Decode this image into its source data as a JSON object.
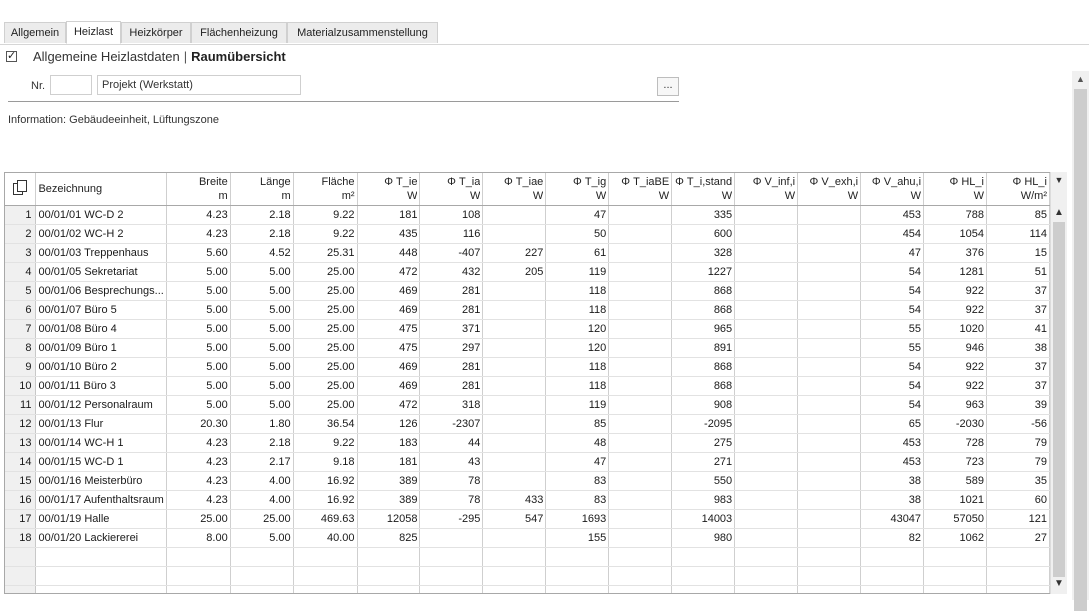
{
  "tabs": [
    {
      "label": "Allgemein"
    },
    {
      "label": "Heizlast",
      "active": true
    },
    {
      "label": "Heizkörper"
    },
    {
      "label": "Flächenheizung"
    },
    {
      "label": "Materialzusammenstellung"
    }
  ],
  "header": {
    "checked": true,
    "title_normal": "Allgemeine Heizlastdaten",
    "separator": "|",
    "title_bold": "Raumübersicht"
  },
  "form": {
    "nr_label": "Nr.",
    "nr_value": "",
    "name_value": "Projekt (Werkstatt)",
    "dots_label": "..."
  },
  "info": "Information: Gebäudeeinheit, Lüftungszone",
  "table": {
    "columns": [
      {
        "l1": "Bezeichnung",
        "l2": ""
      },
      {
        "l1": "Breite",
        "l2": "m"
      },
      {
        "l1": "Länge",
        "l2": "m"
      },
      {
        "l1": "Fläche",
        "l2": "m²"
      },
      {
        "l1": "Φ T_ie",
        "l2": "W"
      },
      {
        "l1": "Φ T_ia",
        "l2": "W"
      },
      {
        "l1": "Φ T_iae",
        "l2": "W"
      },
      {
        "l1": "Φ T_ig",
        "l2": "W"
      },
      {
        "l1": "Φ T_iaBE",
        "l2": "W"
      },
      {
        "l1": "Φ T_i,stand",
        "l2": "W"
      },
      {
        "l1": "Φ V_inf,i",
        "l2": "W"
      },
      {
        "l1": "Φ V_exh,i",
        "l2": "W"
      },
      {
        "l1": "Φ V_ahu,i",
        "l2": "W"
      },
      {
        "l1": "Φ HL_i",
        "l2": "W"
      },
      {
        "l1": "Φ HL_i",
        "l2": "W/m²"
      }
    ],
    "rows": [
      [
        "1",
        "00/01/01 WC-D 2",
        "4.23",
        "2.18",
        "9.22",
        "181",
        "108",
        "",
        "47",
        "",
        "335",
        "",
        "",
        "453",
        "788",
        "85"
      ],
      [
        "2",
        "00/01/02 WC-H 2",
        "4.23",
        "2.18",
        "9.22",
        "435",
        "116",
        "",
        "50",
        "",
        "600",
        "",
        "",
        "454",
        "1054",
        "114"
      ],
      [
        "3",
        "00/01/03 Treppenhaus",
        "5.60",
        "4.52",
        "25.31",
        "448",
        "-407",
        "227",
        "61",
        "",
        "328",
        "",
        "",
        "47",
        "376",
        "15"
      ],
      [
        "4",
        "00/01/05 Sekretariat",
        "5.00",
        "5.00",
        "25.00",
        "472",
        "432",
        "205",
        "119",
        "",
        "1227",
        "",
        "",
        "54",
        "1281",
        "51"
      ],
      [
        "5",
        "00/01/06 Besprechungs...",
        "5.00",
        "5.00",
        "25.00",
        "469",
        "281",
        "",
        "118",
        "",
        "868",
        "",
        "",
        "54",
        "922",
        "37"
      ],
      [
        "6",
        "00/01/07 Büro 5",
        "5.00",
        "5.00",
        "25.00",
        "469",
        "281",
        "",
        "118",
        "",
        "868",
        "",
        "",
        "54",
        "922",
        "37"
      ],
      [
        "7",
        "00/01/08 Büro 4",
        "5.00",
        "5.00",
        "25.00",
        "475",
        "371",
        "",
        "120",
        "",
        "965",
        "",
        "",
        "55",
        "1020",
        "41"
      ],
      [
        "8",
        "00/01/09 Büro 1",
        "5.00",
        "5.00",
        "25.00",
        "475",
        "297",
        "",
        "120",
        "",
        "891",
        "",
        "",
        "55",
        "946",
        "38"
      ],
      [
        "9",
        "00/01/10 Büro 2",
        "5.00",
        "5.00",
        "25.00",
        "469",
        "281",
        "",
        "118",
        "",
        "868",
        "",
        "",
        "54",
        "922",
        "37"
      ],
      [
        "10",
        "00/01/11 Büro 3",
        "5.00",
        "5.00",
        "25.00",
        "469",
        "281",
        "",
        "118",
        "",
        "868",
        "",
        "",
        "54",
        "922",
        "37"
      ],
      [
        "11",
        "00/01/12 Personalraum",
        "5.00",
        "5.00",
        "25.00",
        "472",
        "318",
        "",
        "119",
        "",
        "908",
        "",
        "",
        "54",
        "963",
        "39"
      ],
      [
        "12",
        "00/01/13 Flur",
        "20.30",
        "1.80",
        "36.54",
        "126",
        "-2307",
        "",
        "85",
        "",
        "-2095",
        "",
        "",
        "65",
        "-2030",
        "-56"
      ],
      [
        "13",
        "00/01/14 WC-H 1",
        "4.23",
        "2.18",
        "9.22",
        "183",
        "44",
        "",
        "48",
        "",
        "275",
        "",
        "",
        "453",
        "728",
        "79"
      ],
      [
        "14",
        "00/01/15 WC-D 1",
        "4.23",
        "2.17",
        "9.18",
        "181",
        "43",
        "",
        "47",
        "",
        "271",
        "",
        "",
        "453",
        "723",
        "79"
      ],
      [
        "15",
        "00/01/16 Meisterbüro",
        "4.23",
        "4.00",
        "16.92",
        "389",
        "78",
        "",
        "83",
        "",
        "550",
        "",
        "",
        "38",
        "589",
        "35"
      ],
      [
        "16",
        "00/01/17 Aufenthaltsraum",
        "4.23",
        "4.00",
        "16.92",
        "389",
        "78",
        "433",
        "83",
        "",
        "983",
        "",
        "",
        "38",
        "1021",
        "60"
      ],
      [
        "17",
        "00/01/19 Halle",
        "25.00",
        "25.00",
        "469.63",
        "12058",
        "-295",
        "547",
        "1693",
        "",
        "14003",
        "",
        "",
        "43047",
        "57050",
        "121"
      ],
      [
        "18",
        "00/01/20 Lackiererei",
        "8.00",
        "5.00",
        "40.00",
        "825",
        "",
        "",
        "155",
        "",
        "980",
        "",
        "",
        "82",
        "1062",
        "27"
      ]
    ]
  },
  "icons": {
    "copy": "copy-icon",
    "filter": "filter-dropdown-icon",
    "scroll_up": "scroll-up-icon",
    "scroll_down": "scroll-down-icon"
  }
}
